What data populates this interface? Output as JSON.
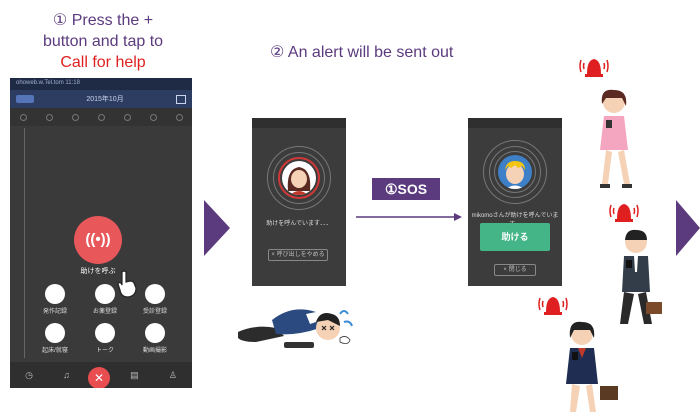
{
  "step1": {
    "num": "①",
    "line1": "Press the +",
    "line2": "button and tap to",
    "line3": "Call for help"
  },
  "step2": {
    "text": "② An alert will be sent out"
  },
  "phone1": {
    "status": "ohoweb.w.Tel.tom  11:18",
    "month": "2015年10月",
    "sos_glyph": "((•))",
    "sos_label": "助けを呼ぶ",
    "menu": [
      {
        "label": "発作記録",
        "icon": "chat-icon"
      },
      {
        "label": "お薬登録",
        "icon": "pill-icon"
      },
      {
        "label": "受診登録",
        "icon": "hospital-icon"
      },
      {
        "label": "起床/就寝",
        "icon": "sun-icon"
      },
      {
        "label": "トーク",
        "icon": "people-icon"
      },
      {
        "label": "動画撮影",
        "icon": "video-icon"
      }
    ],
    "close_glyph": "✕"
  },
  "phone2": {
    "calling_text": "助けを呼んでいます．．．",
    "cancel_label": "× 呼び出しをやめる"
  },
  "sos_banner": "①SOS",
  "phone3": {
    "incoming_text": "mikomoさんが助けを呼んでいます。",
    "help_button": "助ける",
    "close_label": "× 閉じる"
  },
  "colors": {
    "accent": "#5b3a7e",
    "alert_red": "#e02020",
    "sos_red": "#e8575a",
    "help_green": "#43b587"
  }
}
